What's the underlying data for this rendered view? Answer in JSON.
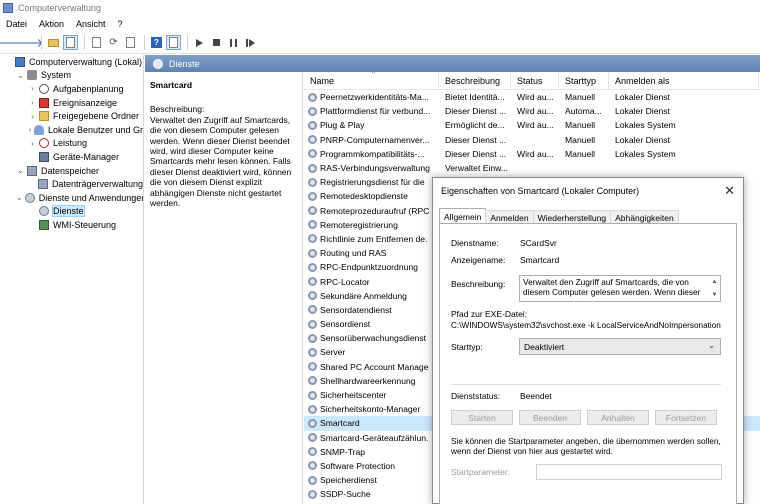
{
  "window": {
    "title": "Computerverwaltung"
  },
  "menu": [
    "Datei",
    "Aktion",
    "Ansicht",
    "?"
  ],
  "tree": [
    {
      "label": "Computerverwaltung (Lokal)",
      "level": 0,
      "expander": "",
      "icon": "computer-icon"
    },
    {
      "label": "System",
      "level": 1,
      "expander": "⌄",
      "icon": "tools-icon"
    },
    {
      "label": "Aufgabenplanung",
      "level": 2,
      "expander": "›",
      "icon": "clock-icon"
    },
    {
      "label": "Ereignisanzeige",
      "level": 2,
      "expander": "›",
      "icon": "event-viewer-icon"
    },
    {
      "label": "Freigegebene Ordner",
      "level": 2,
      "expander": "›",
      "icon": "shared-folder-icon"
    },
    {
      "label": "Lokale Benutzer und Gr",
      "level": 2,
      "expander": "›",
      "icon": "users-icon"
    },
    {
      "label": "Leistung",
      "level": 2,
      "expander": "›",
      "icon": "performance-icon"
    },
    {
      "label": "Geräte-Manager",
      "level": 2,
      "expander": "",
      "icon": "device-manager-icon"
    },
    {
      "label": "Datenspeicher",
      "level": 1,
      "expander": "⌄",
      "icon": "storage-icon"
    },
    {
      "label": "Datenträgerverwaltung",
      "level": 2,
      "expander": "",
      "icon": "disk-icon"
    },
    {
      "label": "Dienste und Anwendungen",
      "level": 1,
      "expander": "⌄",
      "icon": "services-apps-icon"
    },
    {
      "label": "Dienste",
      "level": 2,
      "expander": "",
      "icon": "services-icon",
      "selected": true
    },
    {
      "label": "WMI-Steuerung",
      "level": 2,
      "expander": "",
      "icon": "wmi-icon"
    }
  ],
  "services_header": "Dienste",
  "detail": {
    "name": "Smartcard",
    "description": "Beschreibung:\nVerwaltet den Zugriff auf Smartcards, die von diesem Computer gelesen werden. Wenn dieser Dienst beendet wird, wird dieser Computer keine Smartcards mehr lesen können. Falls dieser Dienst deaktiviert wird, können die von diesem Dienst explizit abhängigen Dienste nicht gestartet werden."
  },
  "columns": [
    "Name",
    "Beschreibung",
    "Status",
    "Starttyp",
    "Anmelden als"
  ],
  "rows": [
    [
      "Peernetzwerkidentitäts-Ma...",
      "Bietet Identitä...",
      "Wird au...",
      "Manuell",
      "Lokaler Dienst"
    ],
    [
      "Plattformdienst für verbund...",
      "Dieser Dienst ...",
      "Wird au...",
      "Automa...",
      "Lokaler Dienst"
    ],
    [
      "Plug & Play",
      "Ermöglicht de...",
      "Wird au...",
      "Manuell",
      "Lokales System"
    ],
    [
      "PNRP-Computernamenver...",
      "Dieser Dienst ...",
      "",
      "Manuell",
      "Lokaler Dienst"
    ],
    [
      "Programmkompatibilitäts-...",
      "Dieser Dienst ...",
      "Wird au...",
      "Manuell",
      "Lokales System"
    ],
    [
      "RAS-Verbindungsverwaltung",
      "Verwaltet Einw...",
      "",
      "",
      ""
    ],
    [
      "Registrierungsdienst für die",
      "",
      "",
      "",
      ""
    ],
    [
      "Remotedesktopdienste",
      "",
      "",
      "",
      ""
    ],
    [
      "Remoteprozeduraufruf (RPC",
      "",
      "",
      "",
      ""
    ],
    [
      "Remoteregistrierung",
      "",
      "",
      "",
      ""
    ],
    [
      "Richtlinie zum Entfernen de.",
      "",
      "",
      "",
      ""
    ],
    [
      "Routing und RAS",
      "",
      "",
      "",
      ""
    ],
    [
      "RPC-Endpunktzuordnung",
      "",
      "",
      "",
      ""
    ],
    [
      "RPC-Locator",
      "",
      "",
      "",
      ""
    ],
    [
      "Sekundäre Anmeldung",
      "",
      "",
      "",
      ""
    ],
    [
      "Sensordatendienst",
      "",
      "",
      "",
      ""
    ],
    [
      "Sensordienst",
      "",
      "",
      "",
      ""
    ],
    [
      "Sensorüberwachungsdienst",
      "",
      "",
      "",
      ""
    ],
    [
      "Server",
      "",
      "",
      "",
      ""
    ],
    [
      "Shared PC Account Manage",
      "",
      "",
      "",
      ""
    ],
    [
      "Shellhardwareerkennung",
      "",
      "",
      "",
      ""
    ],
    [
      "Sicherheitscenter",
      "",
      "",
      "",
      ""
    ],
    [
      "Sicherheitskonto-Manager",
      "",
      "",
      "",
      ""
    ],
    [
      "Smartcard",
      "",
      "",
      "",
      ""
    ],
    [
      "Smartcard-Geräteaufzählun.",
      "",
      "",
      "",
      ""
    ],
    [
      "SNMP-Trap",
      "",
      "",
      "",
      ""
    ],
    [
      "Software Protection",
      "",
      "",
      "",
      ""
    ],
    [
      "Speicherdienst",
      "",
      "",
      "",
      ""
    ],
    [
      "SSDP-Suche",
      "",
      "",
      "",
      ""
    ]
  ],
  "selected_row": 23,
  "dialog": {
    "title": "Eigenschaften von Smartcard (Lokaler Computer)",
    "tabs": [
      "Allgemein",
      "Anmelden",
      "Wiederherstellung",
      "Abhängigkeiten"
    ],
    "service_name_label": "Dienstname:",
    "service_name": "SCardSvr",
    "display_name_label": "Anzeigename:",
    "display_name": "Smartcard",
    "description_label": "Beschreibung:",
    "description": "Verwaltet den Zugriff auf Smartcards, die von diesem Computer gelesen werden. Wenn dieser",
    "exe_path_label": "Pfad zur EXE-Datei:",
    "exe_path": "C:\\WINDOWS\\system32\\svchost.exe -k LocalServiceAndNoImpersonation",
    "start_type_label": "Starttyp:",
    "start_type": "Deaktiviert",
    "status_label": "Dienststatus:",
    "status": "Beendet",
    "buttons": [
      "Starten",
      "Beenden",
      "Anhalten",
      "Fortsetzen"
    ],
    "hint": "Sie können die Startparameter angeben, die übernommen werden sollen, wenn der Dienst von hier aus gestartet wird.",
    "params_label": "Startparameter:"
  }
}
